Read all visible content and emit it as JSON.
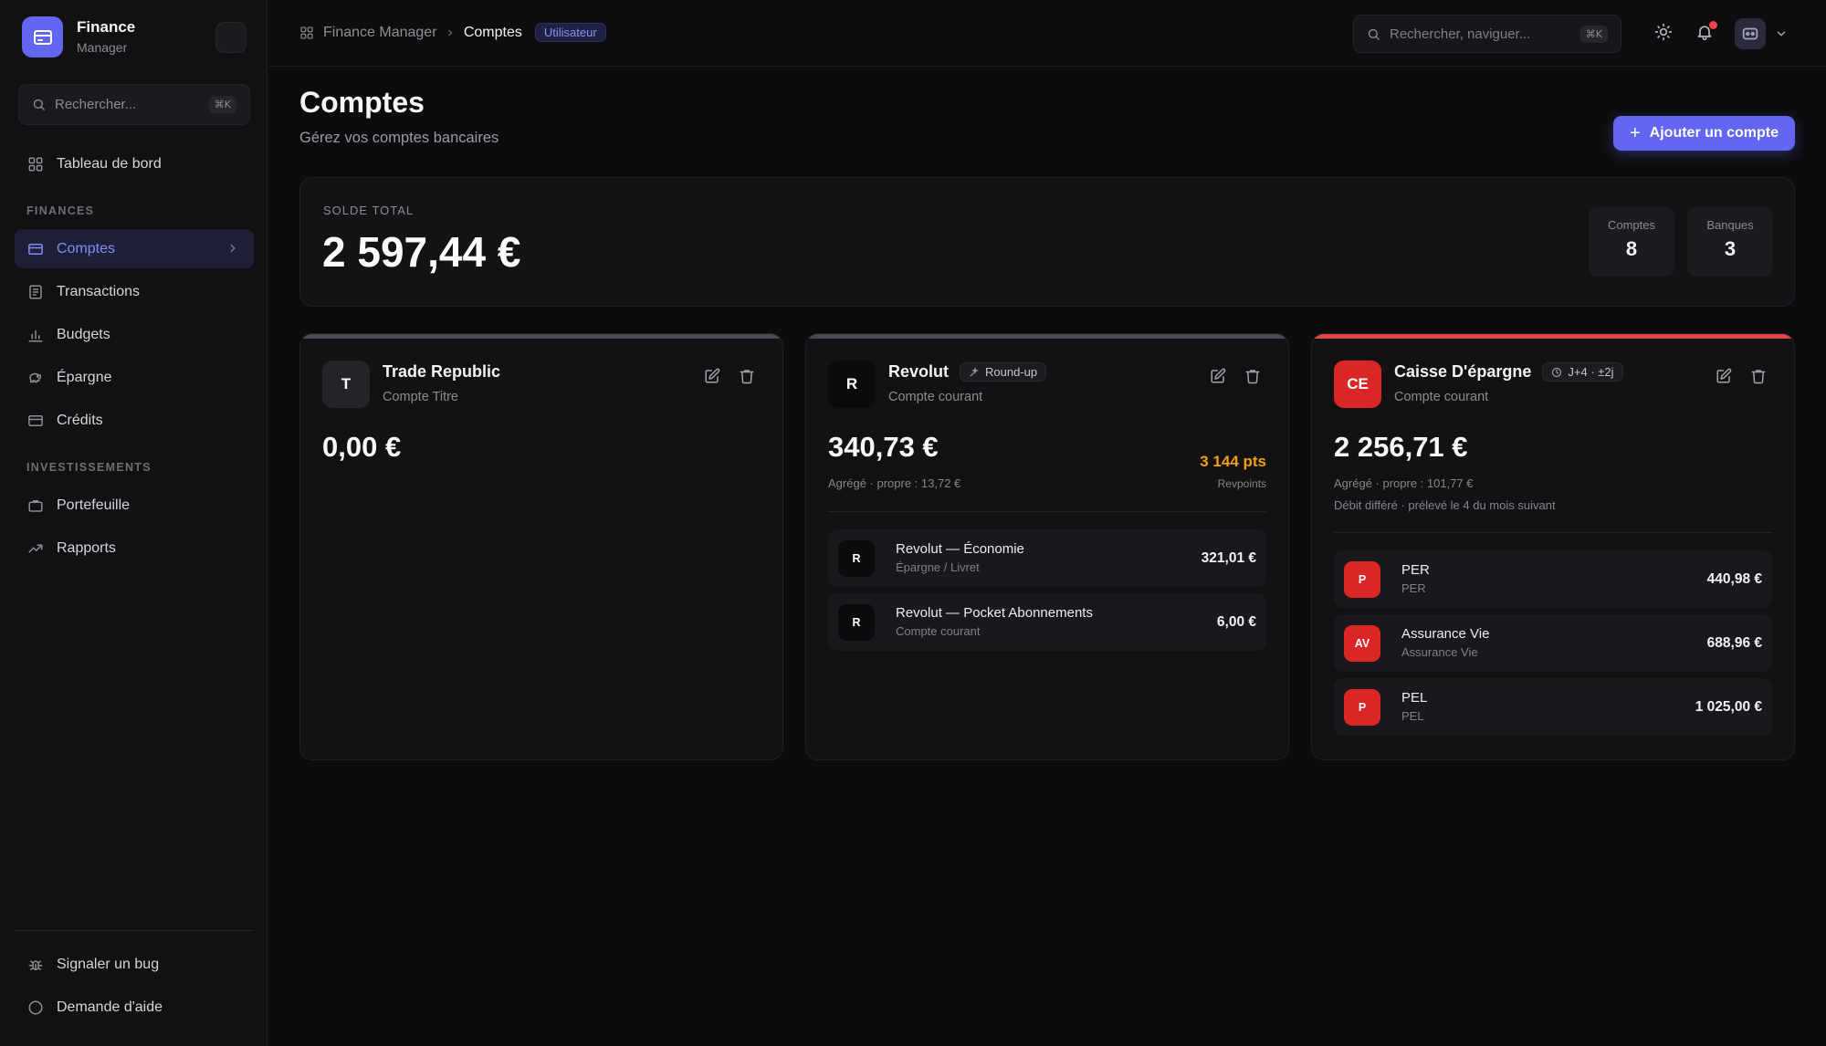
{
  "brand": {
    "name": "Finance",
    "sub": "Manager"
  },
  "sidebar": {
    "search_placeholder": "Rechercher...",
    "search_shortcut": "⌘K",
    "dashboard": "Tableau de bord",
    "section_finances": "FINANCES",
    "section_investments": "INVESTISSEMENTS",
    "items": [
      {
        "label": "Comptes",
        "active": true
      },
      {
        "label": "Transactions"
      },
      {
        "label": "Budgets"
      },
      {
        "label": "Épargne"
      },
      {
        "label": "Crédits"
      },
      {
        "label": "Portefeuille"
      },
      {
        "label": "Rapports"
      }
    ],
    "footer": {
      "bug": "Signaler un bug",
      "help": "Demande d'aide"
    }
  },
  "topbar": {
    "crumb_root": "Finance Manager",
    "crumb_current": "Comptes",
    "role_badge": "Utilisateur",
    "search_placeholder": "Rechercher, naviguer...",
    "search_shortcut": "⌘K"
  },
  "page": {
    "title": "Comptes",
    "subtitle": "Gérez vos comptes bancaires",
    "add_button": "Ajouter un compte"
  },
  "summary": {
    "label": "SOLDE TOTAL",
    "total": "2 597,44 €",
    "accounts_label": "Comptes",
    "accounts_value": "8",
    "banks_label": "Banques",
    "banks_value": "3"
  },
  "accounts": [
    {
      "initials": "T",
      "name": "Trade Republic",
      "type": "Compte Titre",
      "balance": "0,00 €",
      "stripe_color": "#4a4a52",
      "logo_color": "#232329"
    },
    {
      "initials": "R",
      "name": "Revolut",
      "chip": "Round-up",
      "type": "Compte courant",
      "balance": "340,73 €",
      "aggregate": "Agrégé · propre : 13,72 €",
      "points": "3 144 pts",
      "points_label": "Revpoints",
      "stripe_color": "#4a4a52",
      "logo_color": "#0b0b0d",
      "sub_accounts": [
        {
          "initials": "R",
          "name": "Revolut — Économie",
          "type": "Épargne / Livret",
          "value": "321,01 €"
        },
        {
          "initials": "R",
          "name": "Revolut — Pocket Abonnements",
          "type": "Compte courant",
          "value": "6,00 €"
        }
      ]
    },
    {
      "initials": "CE",
      "name": "Caisse D'épargne",
      "chip": "J+4 · ±2j",
      "type": "Compte courant",
      "balance": "2 256,71 €",
      "aggregate": "Agrégé · propre : 101,77 €",
      "deferred": "Débit différé · prélevé le 4 du mois suivant",
      "stripe_color": "#e04848",
      "logo_color": "#dc2626",
      "sub_accounts": [
        {
          "initials": "P",
          "name": "PER",
          "type": "PER",
          "value": "440,98 €"
        },
        {
          "initials": "AV",
          "name": "Assurance Vie",
          "type": "Assurance Vie",
          "value": "688,96 €"
        },
        {
          "initials": "P",
          "name": "PEL",
          "type": "PEL",
          "value": "1 025,00 €"
        }
      ]
    }
  ],
  "colors": {
    "accent": "#6366f1",
    "danger": "#dc2626",
    "points": "#f59e0b"
  }
}
